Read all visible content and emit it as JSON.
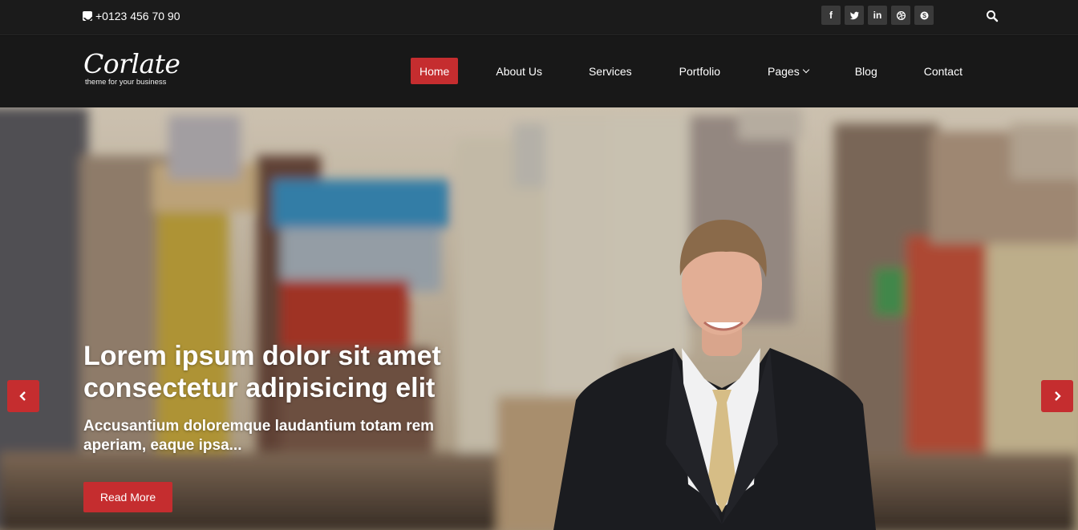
{
  "topbar": {
    "phone": "+0123 456 70 90",
    "socials": [
      {
        "icon": "facebook-icon",
        "glyph": "f"
      },
      {
        "icon": "twitter-icon",
        "glyph": ""
      },
      {
        "icon": "linkedin-icon",
        "glyph": "in"
      },
      {
        "icon": "dribbble-icon",
        "glyph": ""
      },
      {
        "icon": "skype-icon",
        "glyph": ""
      }
    ],
    "search_icon": "search-icon"
  },
  "brand": {
    "name": "Corlate",
    "tagline": "theme for your business"
  },
  "nav": {
    "items": [
      {
        "label": "Home",
        "active": true
      },
      {
        "label": "About Us"
      },
      {
        "label": "Services"
      },
      {
        "label": "Portfolio"
      },
      {
        "label": "Pages",
        "dropdown": true
      },
      {
        "label": "Blog"
      },
      {
        "label": "Contact"
      }
    ]
  },
  "hero": {
    "title": "Lorem ipsum dolor sit amet consectetur adipisicing elit",
    "subtitle": "Accusantium doloremque laudantium totam rem aperiam, eaque ipsa...",
    "cta": "Read More",
    "prev_icon": "chevron-left-icon",
    "next_icon": "chevron-right-icon"
  },
  "colors": {
    "accent": "#c52d2f",
    "topbar": "#1b1b1b",
    "navbar": "#181818"
  }
}
